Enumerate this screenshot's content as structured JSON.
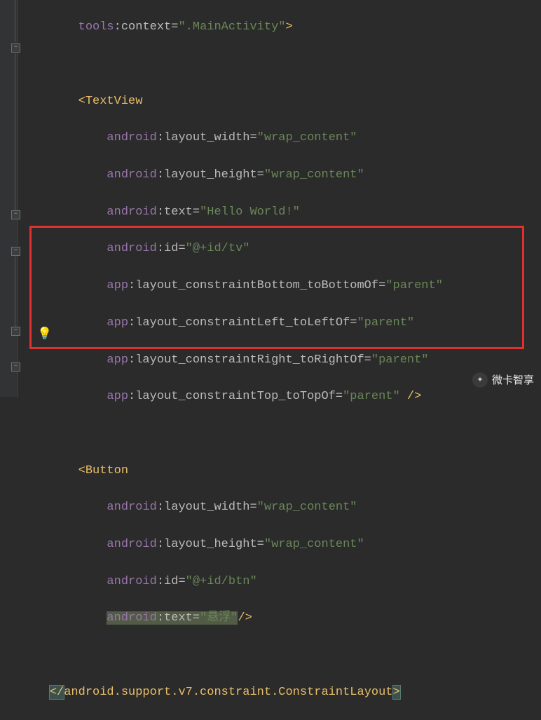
{
  "code": {
    "l1_ns": "tools",
    "l1_attr": ":context=",
    "l1_val": "\".MainActivity\"",
    "l1_end": ">",
    "l2_tag": "<TextView",
    "l3_ns": "android",
    "l3_attr": ":layout_width=",
    "l3_val": "\"wrap_content\"",
    "l4_ns": "android",
    "l4_attr": ":layout_height=",
    "l4_val": "\"wrap_content\"",
    "l5_ns": "android",
    "l5_attr": ":text=",
    "l5_val": "\"Hello World!\"",
    "l6_ns": "android",
    "l6_attr": ":id=",
    "l6_val": "\"@+id/tv\"",
    "l7_ns": "app",
    "l7_attr": ":layout_constraintBottom_toBottomOf=",
    "l7_val": "\"parent\"",
    "l8_ns": "app",
    "l8_attr": ":layout_constraintLeft_toLeftOf=",
    "l8_val": "\"parent\"",
    "l9_ns": "app",
    "l9_attr": ":layout_constraintRight_toRightOf=",
    "l9_val": "\"parent\"",
    "l10_ns": "app",
    "l10_attr": ":layout_constraintTop_toTopOf=",
    "l10_val": "\"parent\"",
    "l10_end": " />",
    "l11_tag": "<Button",
    "l12_ns": "android",
    "l12_attr": ":layout_width=",
    "l12_val": "\"wrap_content\"",
    "l13_ns": "android",
    "l13_attr": ":layout_height=",
    "l13_val": "\"wrap_content\"",
    "l14_ns": "android",
    "l14_attr": ":id=",
    "l14_val": "\"@+id/btn\"",
    "l15_ns": "android",
    "l15_attr": ":text=",
    "l15_val": "\"悬浮\"",
    "l15_end": "/>",
    "l16_open": "</",
    "l16_tag": "android.support.v7.constraint.ConstraintLayout",
    "l16_close": ">"
  },
  "gutter": {
    "bulb": "💡"
  },
  "watermark": {
    "text": "微卡智享"
  }
}
